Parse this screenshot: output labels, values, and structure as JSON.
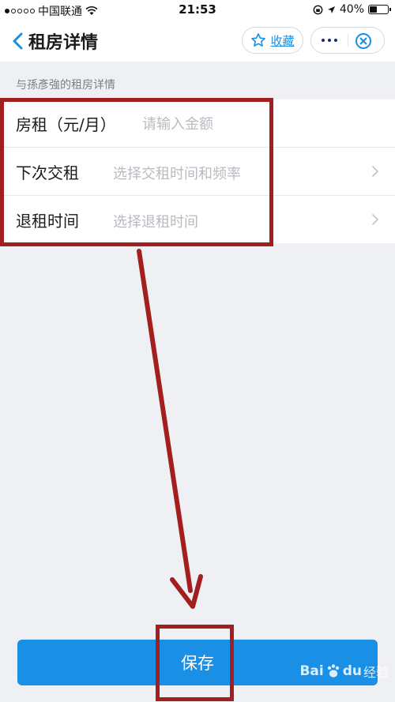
{
  "status_bar": {
    "carrier": "中国联通",
    "time": "21:53",
    "battery": "40%",
    "battery_level": 0.4
  },
  "nav": {
    "back_icon": "chevron-left-icon",
    "title": "租房详情",
    "favorite_icon": "star-outline-icon",
    "favorite_label": "收藏",
    "more_icon": "more-dots-icon",
    "close_icon": "miniapp-close-icon"
  },
  "section": {
    "header": "与孫彥強的租房详情"
  },
  "form": {
    "rent": {
      "label": "房租（元/月）",
      "placeholder": "请输入金额"
    },
    "next_payment": {
      "label": "下次交租",
      "placeholder": "选择交租时间和频率"
    },
    "move_out": {
      "label": "退租时间",
      "placeholder": "选择退租时间"
    }
  },
  "save_button": {
    "label": "保存"
  },
  "watermark": {
    "brand": "Bai",
    "brand_mark": "du",
    "suffix": "经验"
  },
  "colors": {
    "accent": "#1a8fe6",
    "annotation": "#a31e1e",
    "background": "#eff0f4"
  }
}
